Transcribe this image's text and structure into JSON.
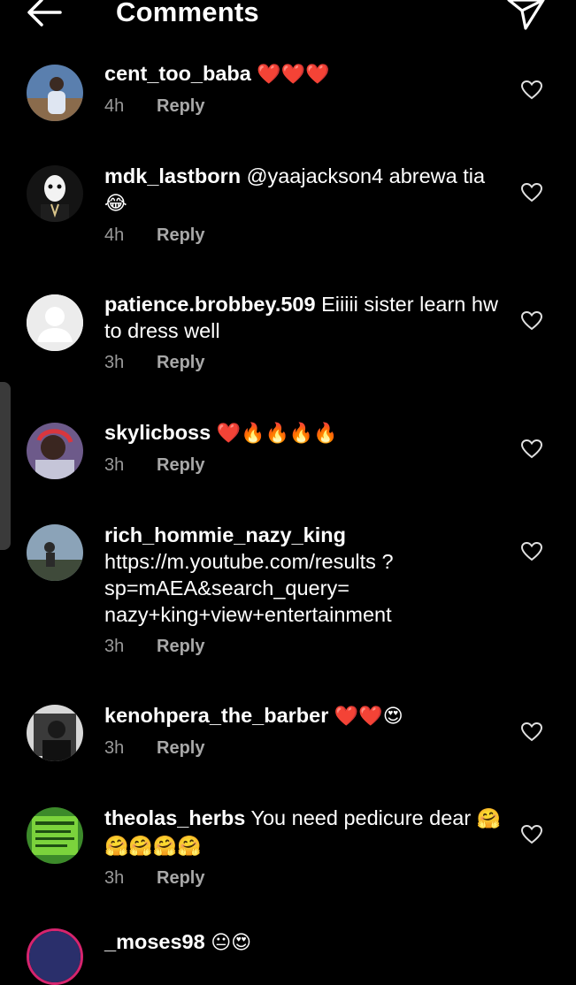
{
  "header": {
    "title": "Comments"
  },
  "reply_label": "Reply",
  "comments": [
    {
      "user": "cent_too_baba",
      "text": "",
      "emoji": "❤️❤️❤️",
      "time": "4h"
    },
    {
      "user": "mdk_lastborn",
      "text": "@yaajackson4 abrewa tia",
      "emoji": "😂",
      "time": "4h"
    },
    {
      "user": "patience.brobbey.509",
      "text": "Eiiiii sister learn hw to dress well",
      "emoji": "",
      "time": "3h"
    },
    {
      "user": "skylicboss",
      "text": "",
      "emoji": "❤️🔥🔥🔥🔥",
      "time": "3h"
    },
    {
      "user": "rich_hommie_nazy_king",
      "text": "https://m.youtube.com/results ?sp=mAEA&search_query= nazy+king+view+entertainment",
      "emoji": "",
      "time": "3h"
    },
    {
      "user": "kenohpera_the_barber",
      "text": "",
      "emoji": "❤️❤️😍",
      "time": "3h"
    },
    {
      "user": "theolas_herbs",
      "text": "You need pedicure dear",
      "emoji": "🤗🤗🤗🤗🤗",
      "time": "3h"
    },
    {
      "user": "_moses98",
      "text": "",
      "emoji": "😐😍",
      "time": ""
    }
  ],
  "colors": {
    "background": "#000000",
    "meta": "#9a9a9a",
    "text": "#ffffff"
  }
}
